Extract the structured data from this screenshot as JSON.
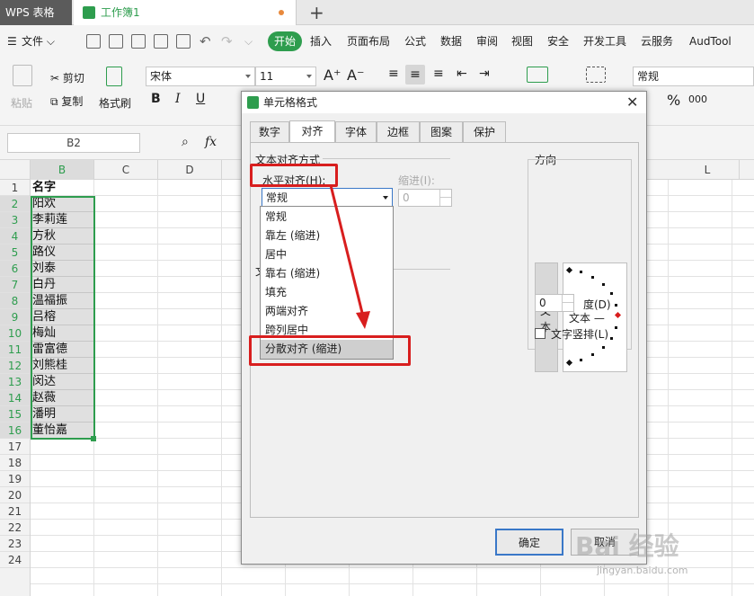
{
  "titlebar": {
    "app_tab": "WPS 表格",
    "workbook_tab": "工作簿1",
    "new_tab": "+"
  },
  "menubar": {
    "file_menu": "文件",
    "items": [
      "开始",
      "插入",
      "页面布局",
      "公式",
      "数据",
      "审阅",
      "视图",
      "安全",
      "开发工具",
      "云服务",
      "AudTool"
    ]
  },
  "ribbon": {
    "paste": "粘贴",
    "cut": "剪切",
    "copy": "复制",
    "format_painter": "格式刷",
    "font_name": "宋体",
    "font_size": "11",
    "number_format": "常规",
    "bold": "B",
    "italic": "I",
    "underline": "U",
    "percent": "%",
    "thousands": "000"
  },
  "formula_bar": {
    "name_box": "B2",
    "fx": "fx"
  },
  "sheet": {
    "columns": [
      "B",
      "C",
      "D",
      "L"
    ],
    "rows": [
      "1",
      "2",
      "3",
      "4",
      "5",
      "6",
      "7",
      "8",
      "9",
      "10",
      "11",
      "12",
      "13",
      "14",
      "15",
      "16",
      "17",
      "18",
      "19",
      "20",
      "21",
      "22",
      "23",
      "24"
    ],
    "cells": [
      "名字",
      "阳欢",
      "李莉莲",
      "方秋",
      "路仪",
      "刘泰",
      "白丹",
      "温福振",
      "吕榕",
      "梅灿",
      "雷富德",
      "刘熊桂",
      "闵达",
      "赵薇",
      "潘明",
      "董怡嘉"
    ]
  },
  "dialog": {
    "title": "单元格格式",
    "close": "✕",
    "tabs": [
      "数字",
      "对齐",
      "字体",
      "边框",
      "图案",
      "保护"
    ],
    "section_alignment": "文本对齐方式",
    "horizontal_label": "水平对齐(H):",
    "horizontal_value": "常规",
    "indent_label": "缩进(I):",
    "indent_value": "0",
    "section_control_fragment": "文",
    "orientation_label": "方向",
    "vertical_text": "文本",
    "dial_text": "文本 —",
    "degree_value": "0",
    "degree_label": "度(D)",
    "vertical_checkbox": "文字竖排(L)",
    "ok": "确定",
    "cancel": "取消"
  },
  "dropdown_options": [
    "常规",
    "靠左 (缩进)",
    "居中",
    "靠右 (缩进)",
    "填充",
    "两端对齐",
    "跨列居中",
    "分散对齐 (缩进)"
  ],
  "watermark": {
    "logo": "Bai 经验",
    "url": "jingyan.baidu.com"
  },
  "colors": {
    "accent": "#2e9d4e",
    "annotation": "#d81e1e"
  }
}
